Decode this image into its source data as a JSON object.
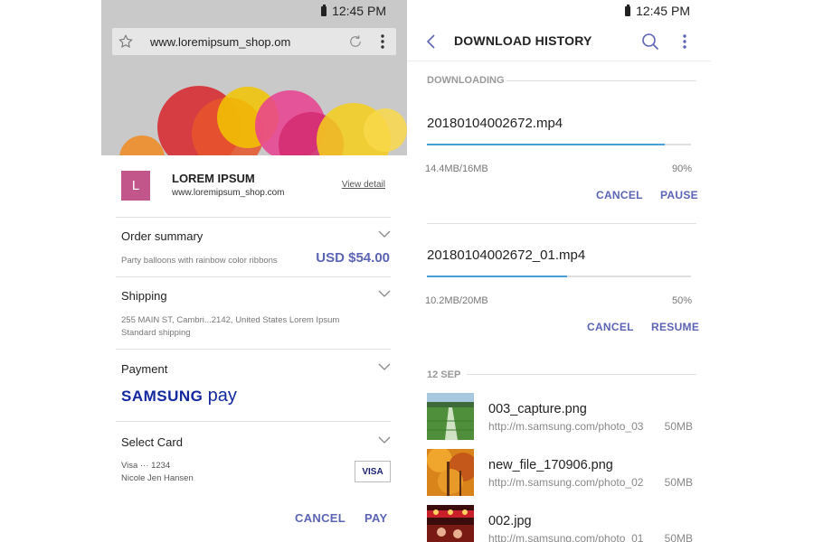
{
  "left": {
    "status": {
      "time": "12:45 PM"
    },
    "browser": {
      "url": "www.loremipsum_shop.om"
    },
    "merchant": {
      "initial": "L",
      "name": "LOREM IPSUM",
      "url": "www.loremipsum_shop.com",
      "view_detail": "View detail"
    },
    "order": {
      "title": "Order summary",
      "item": "Party balloons with rainbow color ribbons",
      "price": "USD $54.00"
    },
    "shipping": {
      "title": "Shipping",
      "address": "255 MAIN ST, Cambri...2142, United States Lorem Ipsum",
      "method": "Standard shipping"
    },
    "payment": {
      "title": "Payment",
      "brand_samsung": "SAMSUNG",
      "brand_pay": "pay"
    },
    "card": {
      "title": "Select Card",
      "number": "Visa ··· 1234",
      "holder": "Nicole Jen Hansen",
      "badge": "VISA"
    },
    "actions": {
      "cancel": "CANCEL",
      "pay": "PAY"
    }
  },
  "right": {
    "status": {
      "time": "12:45 PM"
    },
    "app_bar": {
      "title": "DOWNLOAD HISTORY"
    },
    "downloading": {
      "header": "DOWNLOADING",
      "items": [
        {
          "name": "20180104002672.mp4",
          "size": "14.4MB/16MB",
          "percent": "90%",
          "progress": 0.9,
          "cancel": "CANCEL",
          "action": "PAUSE"
        },
        {
          "name": "20180104002672_01.mp4",
          "size": "10.2MB/20MB",
          "percent": "50%",
          "progress": 0.53,
          "cancel": "CANCEL",
          "action": "RESUME"
        }
      ]
    },
    "history": {
      "date": "12 SEP",
      "items": [
        {
          "name": "003_capture.png",
          "url": "http://m.samsung.com/photo_03",
          "size": "50MB",
          "thumb": "field"
        },
        {
          "name": "new_file_170906.png",
          "url": "http://m.samsung.com/photo_02",
          "size": "50MB",
          "thumb": "autumn"
        },
        {
          "name": "002.jpg",
          "url": "http://m.samsung.com/photo_01",
          "size": "50MB",
          "thumb": "concert"
        }
      ]
    }
  },
  "colors": {
    "accent": "#5b64b5",
    "progress": "#4a9fd8",
    "samsung_pay": "#1428a0",
    "logo": "#c2558a"
  }
}
